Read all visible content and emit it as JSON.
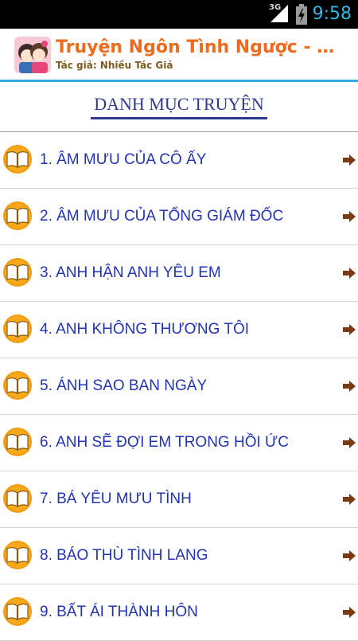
{
  "status_bar": {
    "network": "3G",
    "time": "9:58",
    "icons": [
      "signal-icon",
      "battery-charging-icon"
    ]
  },
  "app_header": {
    "title": "Truyện Ngôn Tình Ngược - Offl...",
    "subtitle": "Tác giả: Nhiều Tác Giả",
    "logo_icon": "couple-logo-icon"
  },
  "section": {
    "heading": "DANH MỤC TRUYỆN"
  },
  "stories": [
    {
      "label": "1. ÂM MƯU CỦA CÔ ẤY"
    },
    {
      "label": "2. ÂM MƯU CỦA TỔNG GIÁM ĐỐC"
    },
    {
      "label": "3. ANH HẬN ANH YÊU EM"
    },
    {
      "label": "4. ANH KHÔNG THƯƠNG TÔI"
    },
    {
      "label": "5. ÁNH SAO BAN NGÀY"
    },
    {
      "label": "6. ANH SẼ ĐỢI EM TRONG HỒI ỨC"
    },
    {
      "label": "7. BÁ YÊU MƯU TÌNH"
    },
    {
      "label": "8. BÁO THÙ TÌNH LANG"
    },
    {
      "label": "9. BẤT ÁI THÀNH HÔN"
    }
  ],
  "item_icons": {
    "leading": "open-book-icon",
    "trailing": "arrow-right-icon"
  },
  "colors": {
    "title": "#ee6a1c",
    "subtitle": "#7d5a1e",
    "accent_rule": "#2ea8df",
    "heading": "#2f3a8f",
    "item_text": "#2233b3",
    "clock": "#33b5e5"
  }
}
